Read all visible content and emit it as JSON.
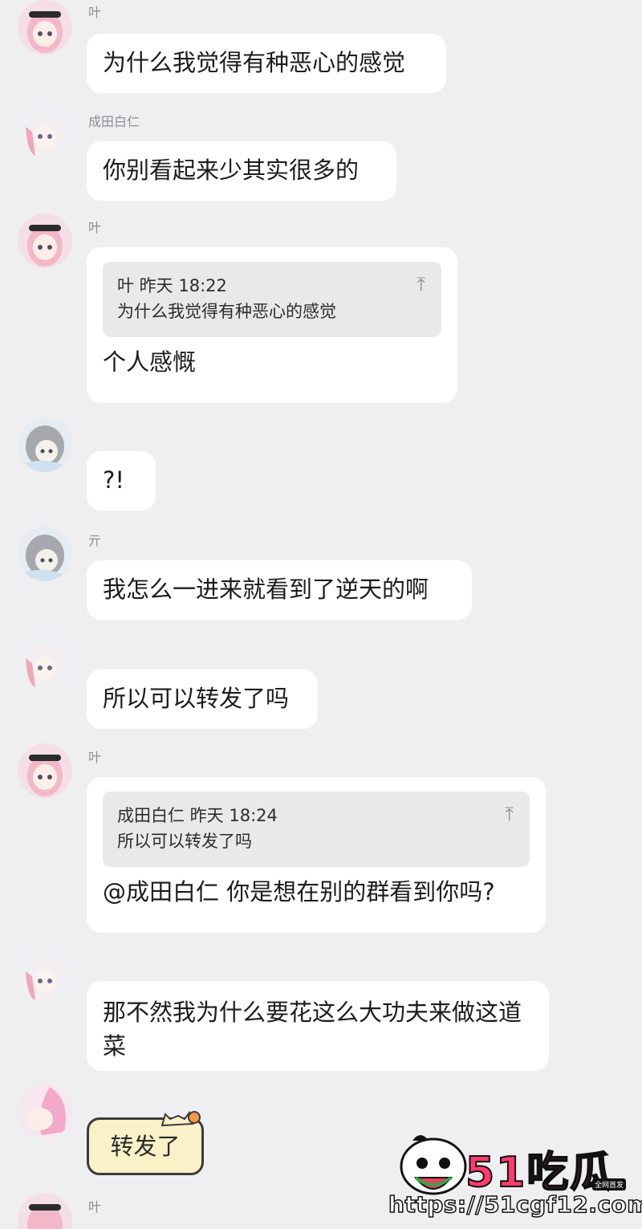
{
  "messages": [
    {
      "sender": "叶",
      "text": "为什么我觉得有种恶心的感觉"
    },
    {
      "sender": "成田白仁",
      "text": "你别看起来少其实很多的"
    },
    {
      "sender": "叶",
      "quote_header": "叶 昨天 18:22",
      "quote_text": "为什么我觉得有种恶心的感觉",
      "text": "个人感慨"
    },
    {
      "sender": "",
      "text": "?!"
    },
    {
      "sender": "亓",
      "text": "我怎么一进来就看到了逆天的啊"
    },
    {
      "sender": "",
      "text": "所以可以转发了吗"
    },
    {
      "sender": "叶",
      "quote_header": "成田白仁 昨天 18:24",
      "quote_text": "所以可以转发了吗",
      "text": "@成田白仁 你是想在别的群看到你吗?"
    },
    {
      "sender": "",
      "text": "那不然我为什么要花这么大功夫来做这道菜"
    },
    {
      "sender": "",
      "sticker_text": "转发了"
    },
    {
      "sender": "叶"
    }
  ],
  "quote_icon": "arrow-up-to-line-icon",
  "watermark": {
    "brand": "51吃瓜",
    "tag": "全网首发",
    "url": "https://51cgf12.com"
  },
  "colors": {
    "background": "#efeff1",
    "bubble": "#ffffff",
    "quote": "#e9e9eb",
    "sticker": "#fbf1c8"
  }
}
